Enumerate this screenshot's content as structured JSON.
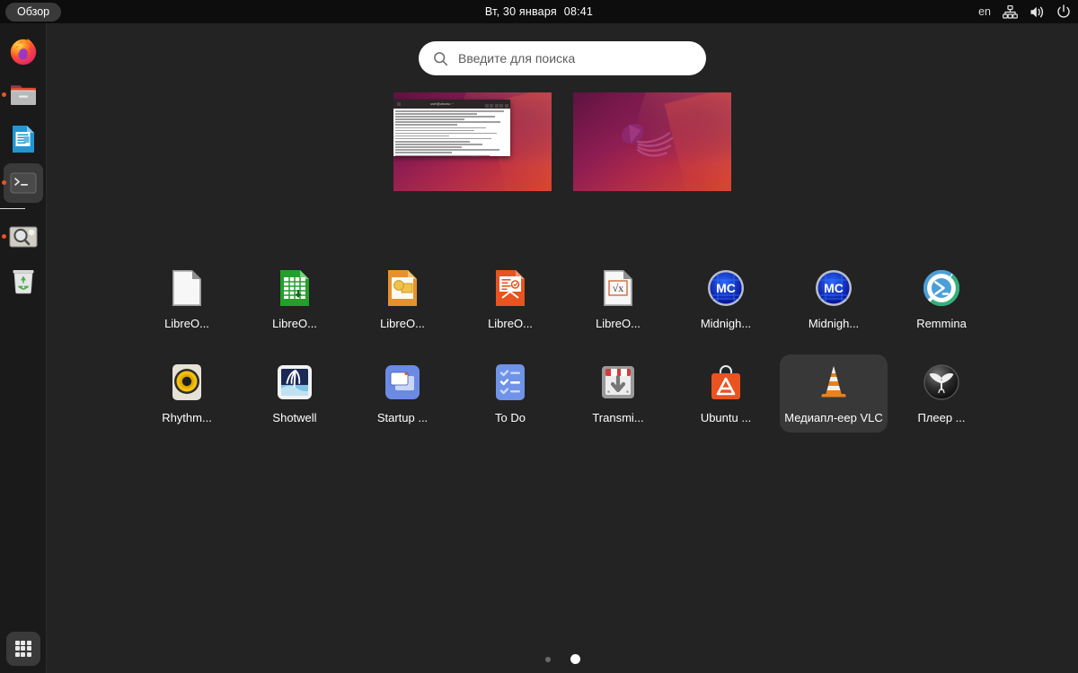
{
  "topbar": {
    "activities_label": "Обзор",
    "clock_day": "Вт, 30 января",
    "clock_time": "08:41",
    "language": "en",
    "icons": [
      "network-icon",
      "volume-icon",
      "power-icon"
    ]
  },
  "dock": {
    "items": [
      {
        "name": "firefox",
        "label": "Firefox",
        "running": false,
        "focused": false
      },
      {
        "name": "files",
        "label": "Файлы",
        "running": true,
        "focused": false
      },
      {
        "name": "libreoffice-writer",
        "label": "LibreOffice Writer",
        "running": false,
        "focused": false
      },
      {
        "name": "terminal",
        "label": "Терминал",
        "running": true,
        "focused": true
      },
      {
        "name": "image-viewer",
        "label": "Просмотр изображений",
        "running": true,
        "focused": false
      },
      {
        "name": "trash",
        "label": "Корзина",
        "running": false,
        "focused": false
      }
    ],
    "apps_button_label": "Показать приложения"
  },
  "search": {
    "placeholder": "Введите для поиска",
    "value": "",
    "icon": "search-icon"
  },
  "workspaces": [
    {
      "name": "workspace-1",
      "has_window": true,
      "window_title": "user@ubuntu: ~",
      "active": false
    },
    {
      "name": "workspace-2",
      "has_window": false,
      "active": true
    }
  ],
  "apps": [
    {
      "label": "LibreO...",
      "icon": "libreoffice-start-center-icon",
      "selected": false
    },
    {
      "label": "LibreO...",
      "icon": "libreoffice-calc-icon",
      "selected": false
    },
    {
      "label": "LibreO...",
      "icon": "libreoffice-draw-icon",
      "selected": false
    },
    {
      "label": "LibreO...",
      "icon": "libreoffice-impress-icon",
      "selected": false
    },
    {
      "label": "LibreO...",
      "icon": "libreoffice-math-icon",
      "selected": false
    },
    {
      "label": "Midnigh...",
      "icon": "midnight-commander-icon",
      "selected": false
    },
    {
      "label": "Midnigh...",
      "icon": "midnight-commander-icon",
      "selected": false
    },
    {
      "label": "Remmina",
      "icon": "remmina-icon",
      "selected": false
    },
    {
      "label": "Rhythm...",
      "icon": "rhythmbox-icon",
      "selected": false
    },
    {
      "label": "Shotwell",
      "icon": "shotwell-icon",
      "selected": false
    },
    {
      "label": "Startup ...",
      "icon": "startup-applications-icon",
      "selected": false
    },
    {
      "label": "To Do",
      "icon": "todo-icon",
      "selected": false
    },
    {
      "label": "Transmi...",
      "icon": "transmission-icon",
      "selected": false
    },
    {
      "label": "Ubuntu ...",
      "icon": "ubuntu-software-icon",
      "selected": false
    },
    {
      "label": "Медиапл-еер VLC",
      "icon": "vlc-icon",
      "selected": true
    },
    {
      "label": "Плеер ...",
      "icon": "mpv-player-icon",
      "selected": false
    }
  ],
  "pages": {
    "count": 2,
    "active_index": 1
  },
  "colors": {
    "accent": "#e95420",
    "topbar_bg": "#0d0d0d",
    "dock_bg": "#1a1a1a",
    "overview_bg": "#232323",
    "selected_bg": "#383838",
    "text": "#ffffff"
  }
}
